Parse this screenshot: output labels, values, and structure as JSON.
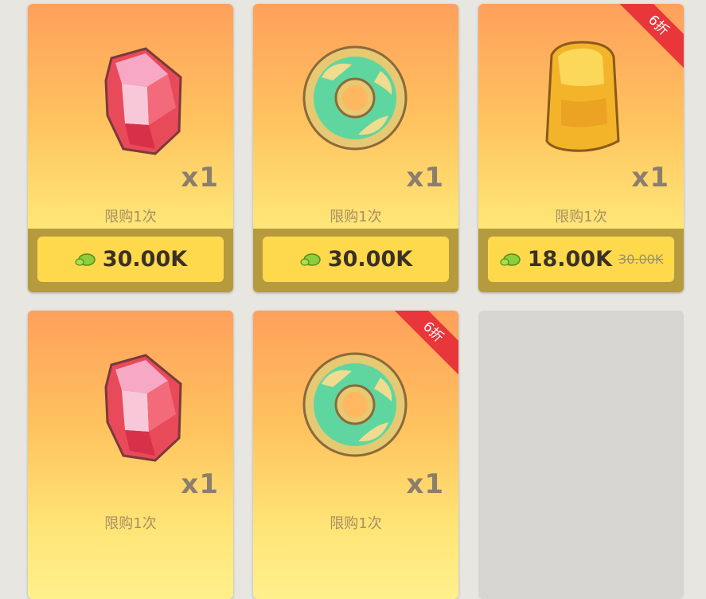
{
  "cards": [
    {
      "item": "red-gem",
      "quantity": "x1",
      "limit": "限购1次",
      "price": "30.00K"
    },
    {
      "item": "jade-ring",
      "quantity": "x1",
      "limit": "限购1次",
      "price": "30.00K"
    },
    {
      "item": "amber-block",
      "quantity": "x1",
      "limit": "限购1次",
      "price": "18.00K",
      "original_price": "30.00K",
      "discount": "6折"
    },
    {
      "item": "red-gem",
      "quantity": "x1",
      "limit": "限购1次"
    },
    {
      "item": "jade-ring",
      "quantity": "x1",
      "limit": "限购1次",
      "discount": "6折"
    }
  ],
  "icons": {
    "currency": "green-leaf-coin-icon"
  },
  "colors": {
    "card_top": "#ffa05c",
    "card_bottom": "#fff08c",
    "button": "#ffd94c",
    "ribbon": "#e8363a"
  }
}
